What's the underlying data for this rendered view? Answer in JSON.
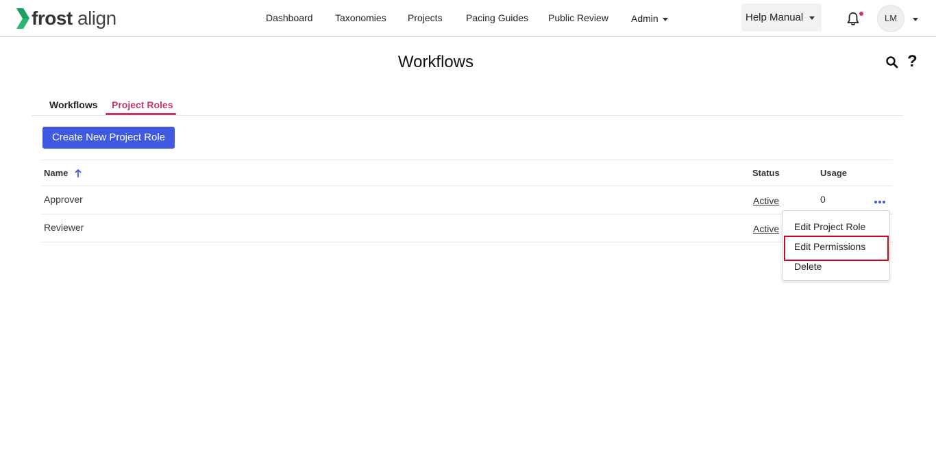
{
  "brand": {
    "logo_bold": "frost",
    "logo_light": "align"
  },
  "nav": {
    "items": [
      "Dashboard",
      "Taxonomies",
      "Projects",
      "Pacing Guides",
      "Public Review"
    ],
    "admin_label": "Admin",
    "help_label": "Help Manual",
    "avatar_initials": "LM"
  },
  "page": {
    "title": "Workflows"
  },
  "tabs": [
    {
      "label": "Workflows",
      "active": false
    },
    {
      "label": "Project Roles",
      "active": true
    }
  ],
  "actions": {
    "create_label": "Create New Project Role"
  },
  "table": {
    "columns": [
      "Name",
      "Status",
      "Usage"
    ],
    "sort": {
      "column": "Name",
      "direction": "asc"
    },
    "rows": [
      {
        "name": "Approver",
        "status": "Active",
        "usage": "0"
      },
      {
        "name": "Reviewer",
        "status": "Active",
        "usage": ""
      }
    ]
  },
  "row_menu": {
    "items": [
      "Edit Project Role",
      "Edit Permissions",
      "Delete"
    ],
    "highlighted": "Edit Permissions"
  },
  "colors": {
    "accent": "#3f5ae0",
    "active_tab": "#c7365f",
    "logo_green": "#2bb673",
    "notification_dot": "#d6336c",
    "highlight": "#d0021b"
  },
  "icons": [
    "logo-chevron-icon",
    "caret-down-icon",
    "bell-icon",
    "search-icon",
    "question-icon",
    "sort-up-icon",
    "more-horizontal-icon"
  ]
}
